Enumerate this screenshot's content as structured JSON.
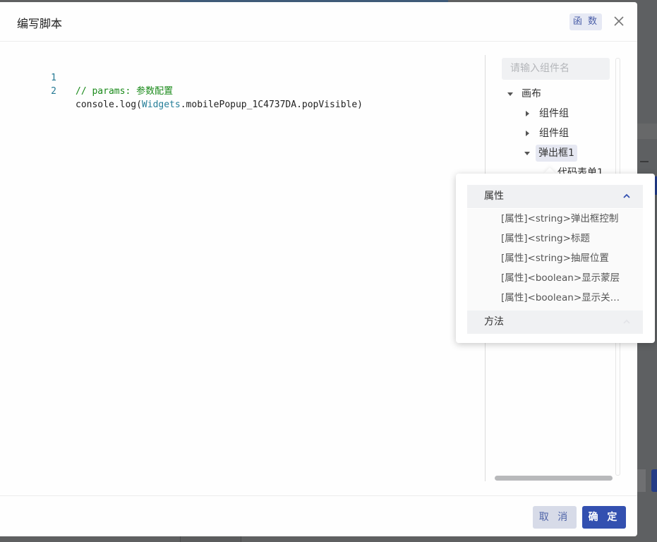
{
  "modal": {
    "title": "编写脚本",
    "badge": "函 数",
    "close_icon": "close-icon"
  },
  "editor": {
    "lines": [
      {
        "number": "1",
        "comment": "// params: 参数配置"
      },
      {
        "number": "2",
        "prefix": "console.log(",
        "ident": "Widgets",
        "suffix": ".mobilePopup_1C4737DA.popVisible)"
      }
    ]
  },
  "tree": {
    "search_placeholder": "请输入组件名",
    "nodes": [
      {
        "label": "画布",
        "icon": "caret-down-icon"
      },
      {
        "label": "组件组",
        "icon": "caret-right-icon"
      },
      {
        "label": "组件组",
        "icon": "caret-right-icon"
      },
      {
        "label": "弹出框1",
        "icon": "caret-down-icon",
        "selected": true
      },
      {
        "label": "代码表单1"
      }
    ]
  },
  "popup": {
    "properties_label": "属性",
    "methods_label": "方法",
    "properties": [
      "[属性]<string>弹出框控制",
      "[属性]<string>标题",
      "[属性]<string>抽屉位置",
      "[属性]<boolean>显示蒙层",
      "[属性]<boolean>显示关闭按钮"
    ]
  },
  "footer": {
    "cancel_label": "取 消",
    "ok_label": "确 定"
  },
  "colors": {
    "accent": "#3350b0",
    "accent_soft": "#d7dbe8",
    "comment_green": "#1a8a1a",
    "identifier_teal": "#267f99",
    "line_number": "#237893"
  }
}
